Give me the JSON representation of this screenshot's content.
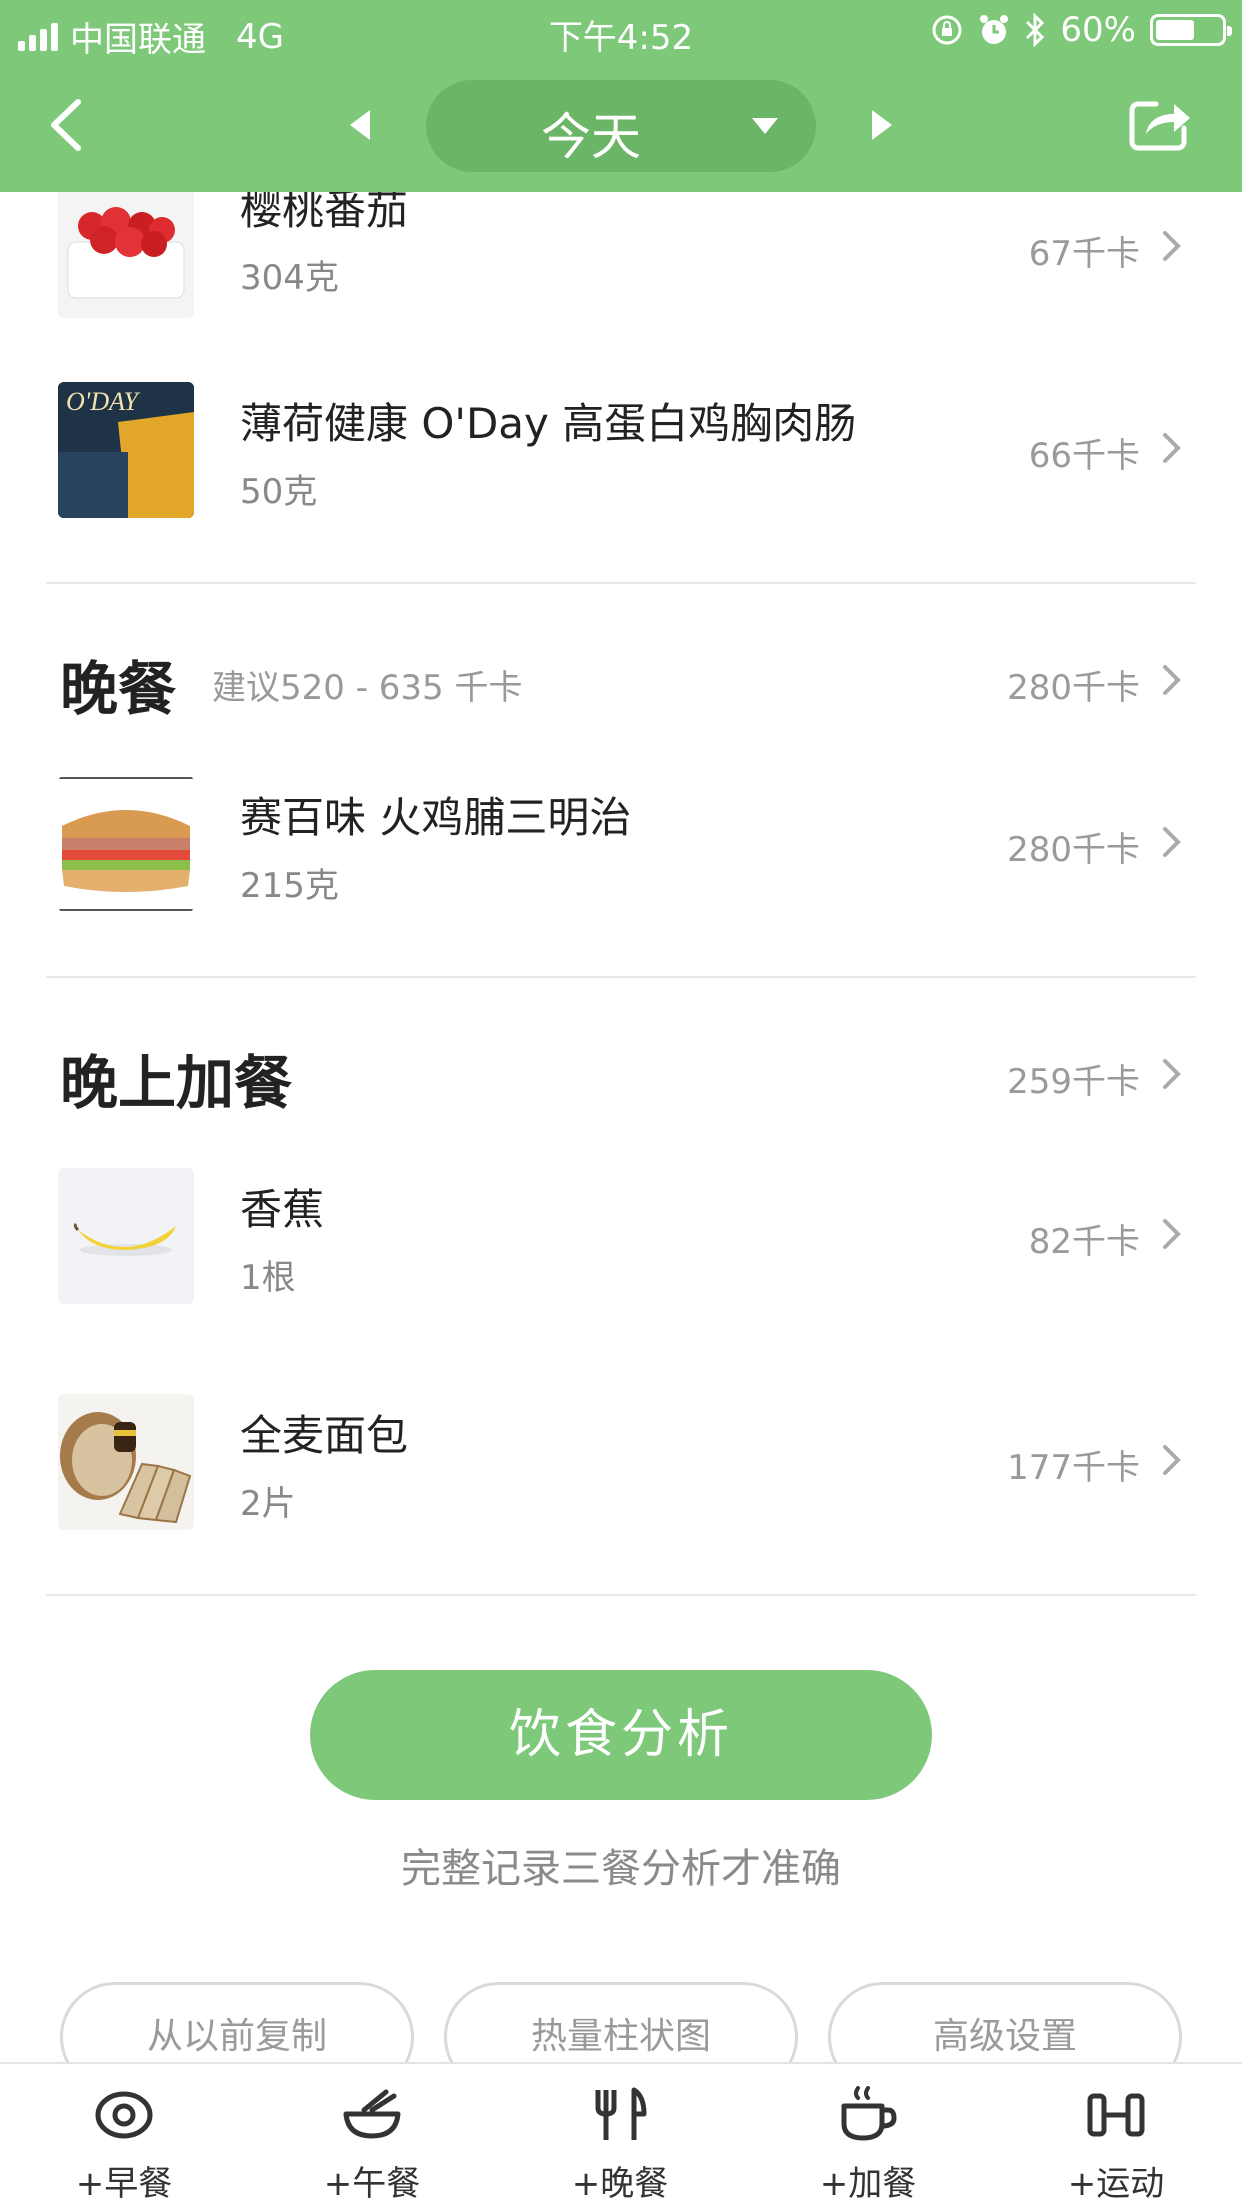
{
  "status_bar": {
    "carrier": "中国联通",
    "network": "4G",
    "time": "下午4:52",
    "battery": "60%",
    "battery_level": 0.6
  },
  "nav": {
    "date_label": "今天"
  },
  "items_top": [
    {
      "name": "樱桃番茄",
      "qty": "304克",
      "kcal": "67千卡"
    },
    {
      "name": "薄荷健康 O'Day 高蛋白鸡胸肉肠",
      "qty": "50克",
      "kcal": "66千卡",
      "thumb_text": "O'DAY"
    }
  ],
  "dinner": {
    "title": "晚餐",
    "hint": "建议520 - 635 千卡",
    "total": "280千卡",
    "items": [
      {
        "name": "赛百味 火鸡脯三明治",
        "qty": "215克",
        "kcal": "280千卡"
      }
    ]
  },
  "night_snack": {
    "title": "晚上加餐",
    "total": "259千卡",
    "items": [
      {
        "name": "香蕉",
        "qty": "1根",
        "kcal": "82千卡"
      },
      {
        "name": "全麦面包",
        "qty": "2片",
        "kcal": "177千卡"
      }
    ]
  },
  "analysis": {
    "button": "饮食分析",
    "note": "完整记录三餐分析才准确"
  },
  "actions": [
    "从以前复制",
    "热量柱状图",
    "高级设置"
  ],
  "tabbar": [
    {
      "label": "+早餐",
      "icon": "egg-icon"
    },
    {
      "label": "+午餐",
      "icon": "bowl-icon"
    },
    {
      "label": "+晚餐",
      "icon": "fork-knife-icon"
    },
    {
      "label": "+加餐",
      "icon": "coffee-cup-icon"
    },
    {
      "label": "+运动",
      "icon": "dumbbell-icon"
    }
  ],
  "colors": {
    "brand_green": "#7ec87a",
    "pill_green": "#6ab566"
  }
}
